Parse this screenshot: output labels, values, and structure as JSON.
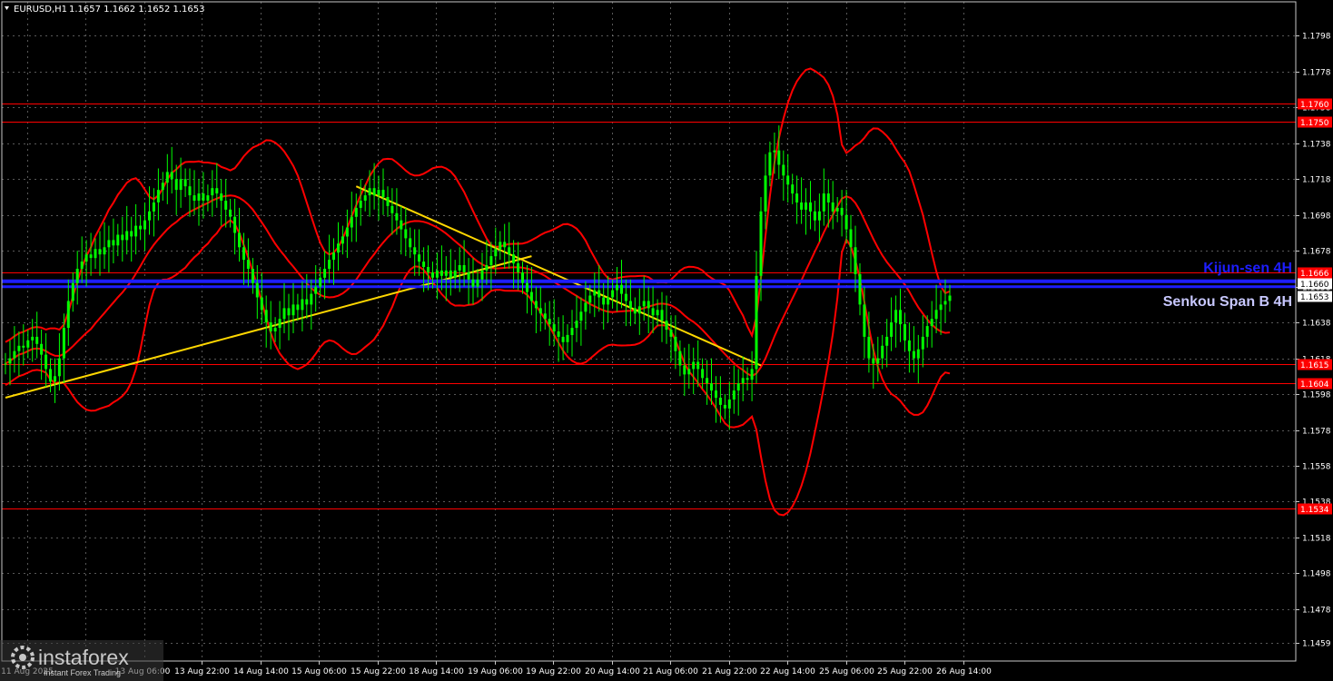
{
  "header": {
    "symbol": "EURUSD,H1",
    "ohlc": "1.1657 1.1662 1.1652 1.1653"
  },
  "colors": {
    "background": "#000000",
    "candle": "#00ff00",
    "bollinger": "#ff0000",
    "level": "#ff0000",
    "trendline": "#ffd700",
    "ichimoku": "#1e1eff",
    "grid": "#a0a0a0"
  },
  "chart_data": {
    "type": "candlestick",
    "title": "EURUSD,H1",
    "ylim": [
      1.1449,
      1.1817
    ],
    "y_ticks": [
      "1.1798",
      "1.1778",
      "1.1758",
      "1.1738",
      "1.1718",
      "1.1698",
      "1.1678",
      "1.1658",
      "1.1638",
      "1.1618",
      "1.1598",
      "1.1578",
      "1.1558",
      "1.1538",
      "1.1518",
      "1.1498",
      "1.1478",
      "1.1459"
    ],
    "x_ticks": [
      "13 Aug 22:00",
      "14 Aug 14:00",
      "15 Aug 06:00",
      "15 Aug 22:00",
      "18 Aug 14:00",
      "19 Aug 06:00",
      "19 Aug 22:00",
      "20 Aug 14:00",
      "21 Aug 06:00",
      "21 Aug 22:00",
      "22 Aug 14:00",
      "25 Aug 06:00",
      "25 Aug 22:00",
      "26 Aug 14:00"
    ],
    "x_ticks_partial": [
      "11 Aug 2025",
      "13 Aug 06:00"
    ],
    "horizontal_levels": [
      {
        "value": 1.176,
        "label": "1.1760"
      },
      {
        "value": 1.175,
        "label": "1.1750"
      },
      {
        "value": 1.1666,
        "label": "1.1666"
      },
      {
        "value": 1.1615,
        "label": "1.1615"
      },
      {
        "value": 1.1604,
        "label": "1.1604"
      },
      {
        "value": 1.1534,
        "label": "1.1534"
      }
    ],
    "ichimoku": [
      {
        "name": "Kijun-sen 4H",
        "value": 1.1661
      },
      {
        "name": "Senkou Span B 4H",
        "value": 1.1658
      }
    ],
    "current_price": "1.1653",
    "hidden_price_label": "1.1660",
    "price_series_hourly": [
      1.1615,
      1.1618,
      1.1622,
      1.1625,
      1.1624,
      1.1628,
      1.163,
      1.1626,
      1.162,
      1.1612,
      1.1605,
      1.1608,
      1.1618,
      1.1635,
      1.165,
      1.166,
      1.1668,
      1.1672,
      1.1676,
      1.1674,
      1.1679,
      1.1676,
      1.168,
      1.1684,
      1.1681,
      1.1687,
      1.1684,
      1.1689,
      1.1686,
      1.1692,
      1.169,
      1.1695,
      1.17,
      1.1705,
      1.1712,
      1.1716,
      1.1722,
      1.1718,
      1.1712,
      1.1718,
      1.1714,
      1.1709,
      1.1706,
      1.171,
      1.1706,
      1.1709,
      1.1713,
      1.171,
      1.1706,
      1.1701,
      1.1697,
      1.1688,
      1.168,
      1.1673,
      1.1668,
      1.166,
      1.1652,
      1.1645,
      1.1638,
      1.1633,
      1.1635,
      1.164,
      1.1646,
      1.1642,
      1.1648,
      1.1645,
      1.1651,
      1.1648,
      1.1654,
      1.1658,
      1.1663,
      1.1668,
      1.1673,
      1.1677,
      1.1682,
      1.1686,
      1.1691,
      1.1697,
      1.1702,
      1.1706,
      1.1709,
      1.1713,
      1.1709,
      1.1712,
      1.1708,
      1.1703,
      1.1699,
      1.1695,
      1.169,
      1.1685,
      1.168,
      1.1676,
      1.1672,
      1.1669,
      1.1666,
      1.1663,
      1.1667,
      1.1664,
      1.1667,
      1.1663,
      1.1667,
      1.167,
      1.1666,
      1.1662,
      1.1658,
      1.1662,
      1.1667,
      1.167,
      1.1675,
      1.1679,
      1.1683,
      1.168,
      1.1676,
      1.1671,
      1.1666,
      1.166,
      1.1655,
      1.165,
      1.1646,
      1.1643,
      1.164,
      1.1637,
      1.1633,
      1.163,
      1.1627,
      1.1631,
      1.1635,
      1.1639,
      1.1644,
      1.1649,
      1.1653,
      1.1656,
      1.1652,
      1.1648,
      1.1652,
      1.1656,
      1.1659,
      1.1654,
      1.165,
      1.1646,
      1.1643,
      1.1647,
      1.165,
      1.1646,
      1.1642,
      1.1645,
      1.1639,
      1.1634,
      1.163,
      1.1622,
      1.1614,
      1.1609,
      1.1612,
      1.1616,
      1.1612,
      1.1607,
      1.1604,
      1.16,
      1.1596,
      1.1592,
      1.159,
      1.1595,
      1.16,
      1.1604,
      1.1607,
      1.1606,
      1.1612,
      1.1664,
      1.17,
      1.172,
      1.1733,
      1.1734,
      1.1726,
      1.172,
      1.1715,
      1.171,
      1.1705,
      1.1701,
      1.1705,
      1.17,
      1.1695,
      1.17,
      1.171,
      1.1705,
      1.17,
      1.1702,
      1.1698,
      1.169,
      1.168,
      1.1665,
      1.1648,
      1.163,
      1.1618,
      1.1615,
      1.1618,
      1.1625,
      1.163,
      1.1638,
      1.1645,
      1.1637,
      1.1628,
      1.1622,
      1.1618,
      1.1623,
      1.163,
      1.1636,
      1.164,
      1.1645,
      1.1648,
      1.165,
      1.1653
    ]
  },
  "logo": {
    "brand": "instaforex",
    "tagline": "Instant Forex Trading"
  },
  "icons": [
    "dropdown-triangle-icon",
    "instaforex-logo-icon"
  ]
}
